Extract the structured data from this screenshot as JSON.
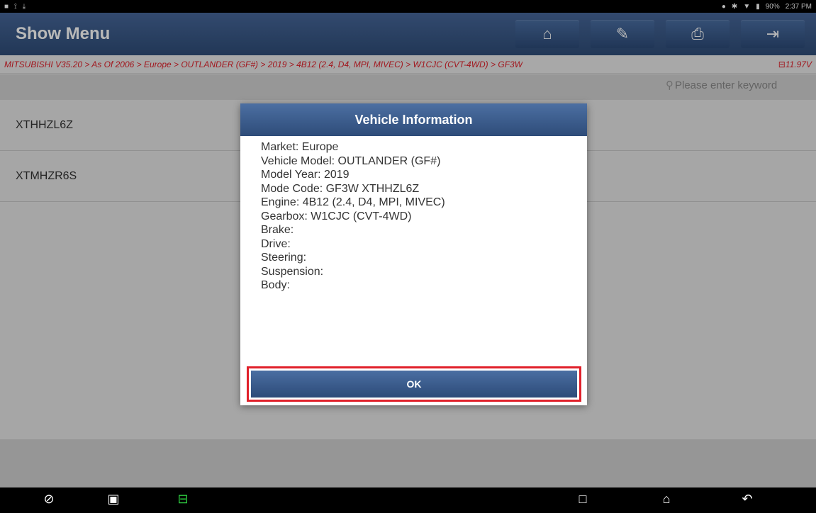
{
  "status_bar": {
    "left_icons": [
      "notification-icon",
      "usb-icon",
      "download-icon"
    ],
    "battery": "90%",
    "time": "2:37 PM"
  },
  "header": {
    "title": "Show Menu",
    "buttons": [
      {
        "icon": "home-icon",
        "glyph": "⌂"
      },
      {
        "icon": "edit-icon",
        "glyph": "✎"
      },
      {
        "icon": "print-icon",
        "glyph": "⎙"
      },
      {
        "icon": "exit-icon",
        "glyph": "⇥"
      }
    ]
  },
  "breadcrumb": {
    "path": "MITSUBISHI V35.20 > As Of 2006 > Europe > OUTLANDER (GF#) > 2019 > 4B12 (2.4, D4, MPI, MIVEC) > W1CJC (CVT-4WD) > GF3W",
    "voltage": "11.97V"
  },
  "search": {
    "placeholder": "Please enter keyword"
  },
  "list": {
    "items": [
      "XTHHZL6Z",
      "XTMHZR6S"
    ]
  },
  "dialog": {
    "title": "Vehicle Information",
    "lines": [
      "Market: Europe",
      "Vehicle Model: OUTLANDER (GF#)",
      "Model Year: 2019",
      "Mode Code: GF3W XTHHZL6Z",
      "Engine: 4B12 (2.4, D4, MPI, MIVEC)",
      "Gearbox: W1CJC (CVT-4WD)",
      "Brake:",
      "Drive:",
      "Steering:",
      "Suspension:",
      "Body:"
    ],
    "ok_label": "OK"
  },
  "colors": {
    "header_blue": "#3d5b84",
    "breadcrumb_red": "#e0202a",
    "highlight_red": "#e0202a"
  }
}
